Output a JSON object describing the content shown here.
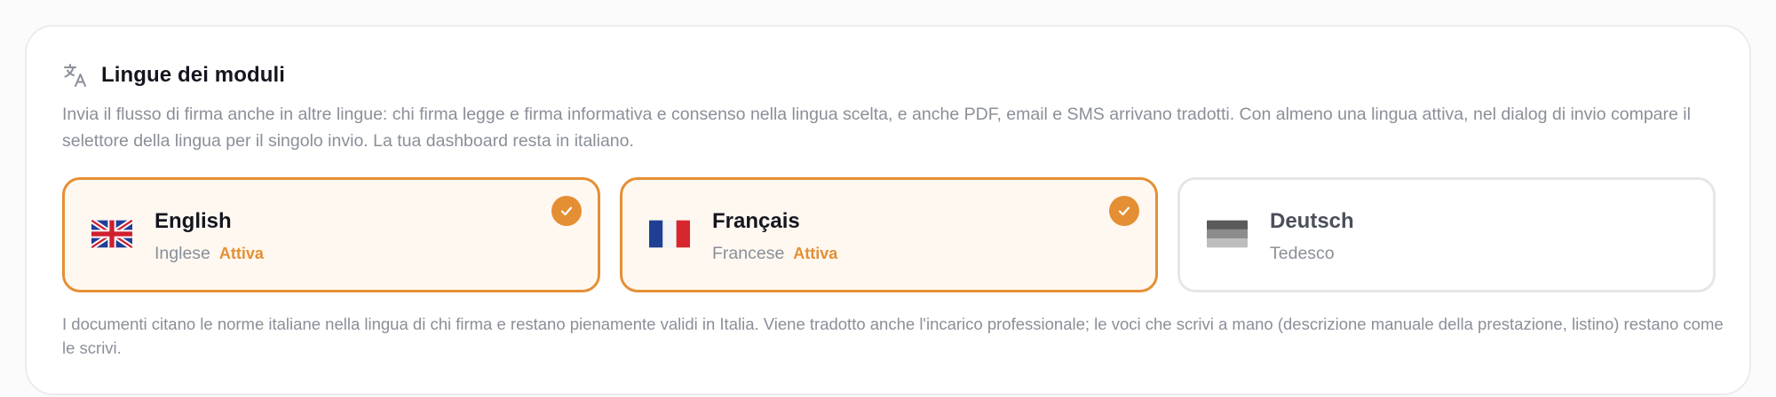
{
  "section": {
    "icon": "translate-icon",
    "title": "Lingue dei moduli",
    "description": "Invia il flusso di firma anche in altre lingue: chi firma legge e firma informativa e consenso nella lingua scelta, e anche PDF, email e SMS arrivano tradotti. Con almeno una lingua attiva, nel dialog di invio compare il selettore della lingua per il singolo invio. La tua dashboard resta in italiano."
  },
  "languages": [
    {
      "name": "English",
      "italian_name": "Inglese",
      "status": "Attiva",
      "active": true,
      "flag_icon": "uk-flag-icon"
    },
    {
      "name": "Français",
      "italian_name": "Francese",
      "status": "Attiva",
      "active": true,
      "flag_icon": "france-flag-icon"
    },
    {
      "name": "Deutsch",
      "italian_name": "Tedesco",
      "status": "",
      "active": false,
      "flag_icon": "germany-flag-icon"
    }
  ],
  "footnote": "I documenti citano le norme italiane nella lingua di chi firma e restano pienamente validi in Italia. Viene tradotto anche l'incarico professionale; le voci che scrivi a mano (descrizione manuale della prestazione, listino) restano come le scrivi.",
  "colors": {
    "accent": "#e48f34",
    "active_background": "#fff8f1",
    "muted_text": "#8a8f98"
  }
}
